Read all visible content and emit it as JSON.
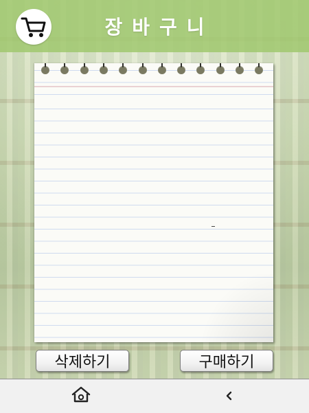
{
  "header": {
    "title": "장바구니",
    "cart_icon": "shopping-cart-icon"
  },
  "notebook": {
    "ring_icon": "spiral-ring-icon",
    "ring_count": 12,
    "mark": "-"
  },
  "actions": {
    "delete_label": "삭제하기",
    "buy_label": "구매하기"
  },
  "bottom_bar": {
    "home_icon": "home-icon",
    "back_icon": "chevron-left-icon"
  },
  "colors": {
    "header": "#a0c86e",
    "notebook": "#fbfbf7",
    "bottom_bar": "#f1f1f1"
  }
}
